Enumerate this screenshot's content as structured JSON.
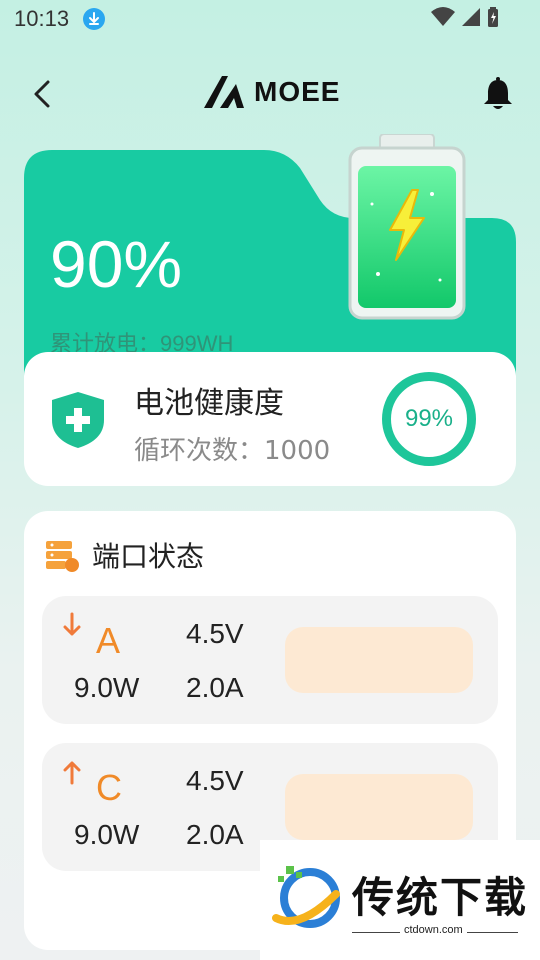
{
  "status_bar": {
    "time": "10:13"
  },
  "header": {
    "brand": "MOEE"
  },
  "battery": {
    "percent": "90%",
    "discharge_label": "累计放电：999WH"
  },
  "health": {
    "title": "电池健康度",
    "cycles_label": "循环次数：1000",
    "percent": "99%",
    "percent_value": 99
  },
  "ports": {
    "title": "端口状态",
    "items": [
      {
        "letter": "A",
        "direction": "down",
        "voltage": "4.5V",
        "power": "9.0W",
        "current": "2.0A"
      },
      {
        "letter": "C",
        "direction": "up",
        "voltage": "4.5V",
        "power": "9.0W",
        "current": "2.0A"
      }
    ]
  },
  "watermark": {
    "title": "传统下载",
    "url": "ctdown.com"
  },
  "colors": {
    "accent": "#1ec69a",
    "card_green": "#18cba2",
    "port_orange": "#f08a28",
    "port_bar": "#fde9d3"
  }
}
